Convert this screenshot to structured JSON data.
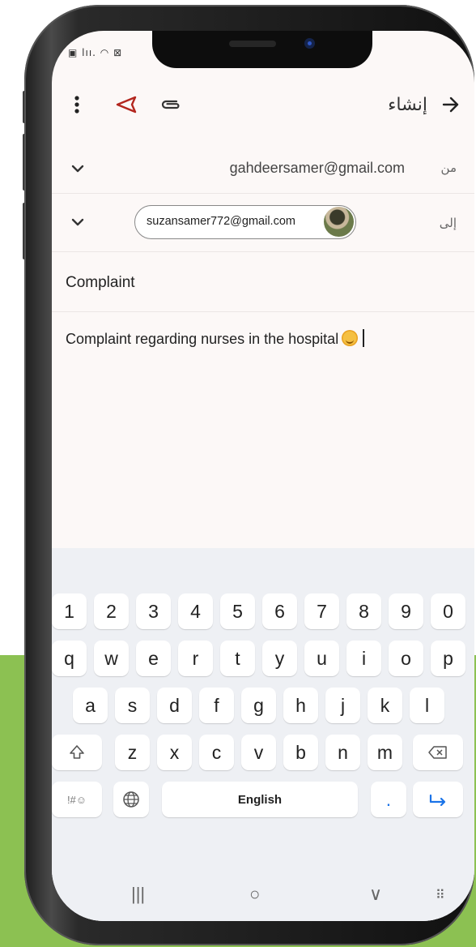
{
  "status_bar": {
    "icons": "▣ lıı. ◠ ⊠"
  },
  "app_bar": {
    "title": "إنشاء",
    "icons": [
      "more-vert-icon",
      "send-icon",
      "attach-icon",
      "arrow-forward-icon"
    ]
  },
  "compose": {
    "from_label": "من",
    "from_email": "gahdeersamer@gmail.com",
    "to_label": "إلى",
    "to_chip": "suzansamer772@gmail.com",
    "subject": "Complaint",
    "body": "Complaint regarding nurses in the hospital"
  },
  "keyboard": {
    "number_row": [
      "1",
      "2",
      "3",
      "4",
      "5",
      "6",
      "7",
      "8",
      "9",
      "0"
    ],
    "row1": [
      "q",
      "w",
      "e",
      "r",
      "t",
      "y",
      "u",
      "i",
      "o",
      "p"
    ],
    "row2": [
      "a",
      "s",
      "d",
      "f",
      "g",
      "h",
      "j",
      "k",
      "l"
    ],
    "row3": [
      "z",
      "x",
      "c",
      "v",
      "b",
      "n",
      "m"
    ],
    "symbols_key": "!#☺",
    "space_label": "English",
    "period_key": "."
  },
  "nav_bar": {
    "recents": "|||",
    "home": "○",
    "back": "∨",
    "keyboard": "⠿"
  },
  "colors": {
    "accent": "#b3261e",
    "green_bg": "#8cc152",
    "screen_bg": "#fcf8f7"
  }
}
